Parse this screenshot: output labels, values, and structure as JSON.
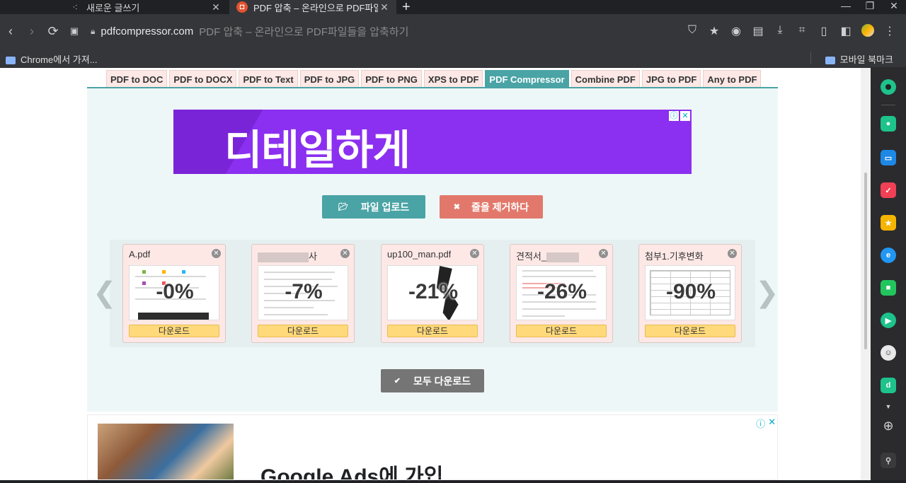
{
  "browser": {
    "tabs": [
      {
        "title": "새로운 글쓰기",
        "active": false
      },
      {
        "title": "PDF 압축 – 온라인으로 PDF파일",
        "active": true
      }
    ],
    "new_tab": "+",
    "address": {
      "domain": "pdfcompressor.com",
      "page_title": "PDF 압축 – 온라인으로 PDF파일들을 압축하기"
    },
    "bookmarks": {
      "left": "Chrome에서 가져...",
      "right": "모바일 북마크"
    }
  },
  "site": {
    "nav_tabs": [
      {
        "label": "PDF to DOC",
        "active": false
      },
      {
        "label": "PDF to DOCX",
        "active": false
      },
      {
        "label": "PDF to Text",
        "active": false
      },
      {
        "label": "PDF to JPG",
        "active": false
      },
      {
        "label": "PDF to PNG",
        "active": false
      },
      {
        "label": "XPS to PDF",
        "active": false
      },
      {
        "label": "PDF Compressor",
        "active": true
      },
      {
        "label": "Combine PDF",
        "active": false
      },
      {
        "label": "JPG to PDF",
        "active": false
      },
      {
        "label": "Any to PDF",
        "active": false
      }
    ],
    "ad_banner_text": "디테일하게",
    "upload_button": "파일 업로드",
    "clear_button": "줄을 제거하다",
    "files": [
      {
        "name": "A.pdf",
        "percent": "-0%",
        "download": "다운로드",
        "thumb": "doc"
      },
      {
        "name": "사",
        "percent": "-7%",
        "download": "다운로드",
        "thumb": "form",
        "masked": true
      },
      {
        "name": "up100_man.pdf",
        "percent": "-21%",
        "download": "다운로드",
        "thumb": "ink"
      },
      {
        "name": "견적서_",
        "percent": "-26%",
        "download": "다운로드",
        "thumb": "quote",
        "masked": true
      },
      {
        "name": "첨부1.기후변화",
        "percent": "-90%",
        "download": "다운로드",
        "thumb": "table"
      }
    ],
    "download_all": "모두 다운로드",
    "ad2_headline": "Google Ads에 가입"
  }
}
